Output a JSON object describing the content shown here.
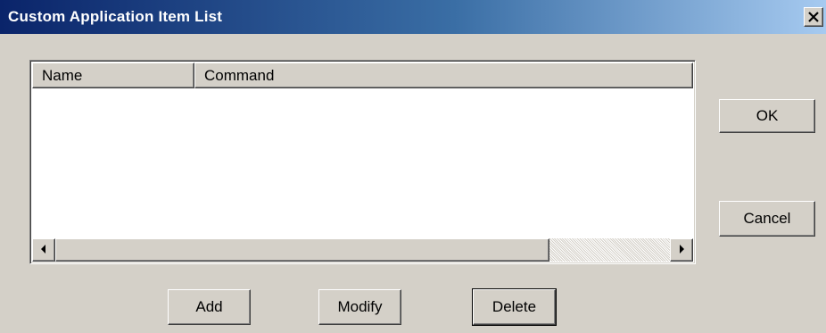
{
  "window": {
    "title": "Custom Application Item List",
    "close_icon": "close-icon"
  },
  "list": {
    "columns": [
      "Name",
      "Command"
    ],
    "rows": []
  },
  "buttons": {
    "ok": "OK",
    "cancel": "Cancel",
    "add": "Add",
    "modify": "Modify",
    "delete": "Delete"
  },
  "colors": {
    "titlebar_start": "#0a246a",
    "titlebar_end": "#a6caf0",
    "face": "#d4d0c8"
  }
}
